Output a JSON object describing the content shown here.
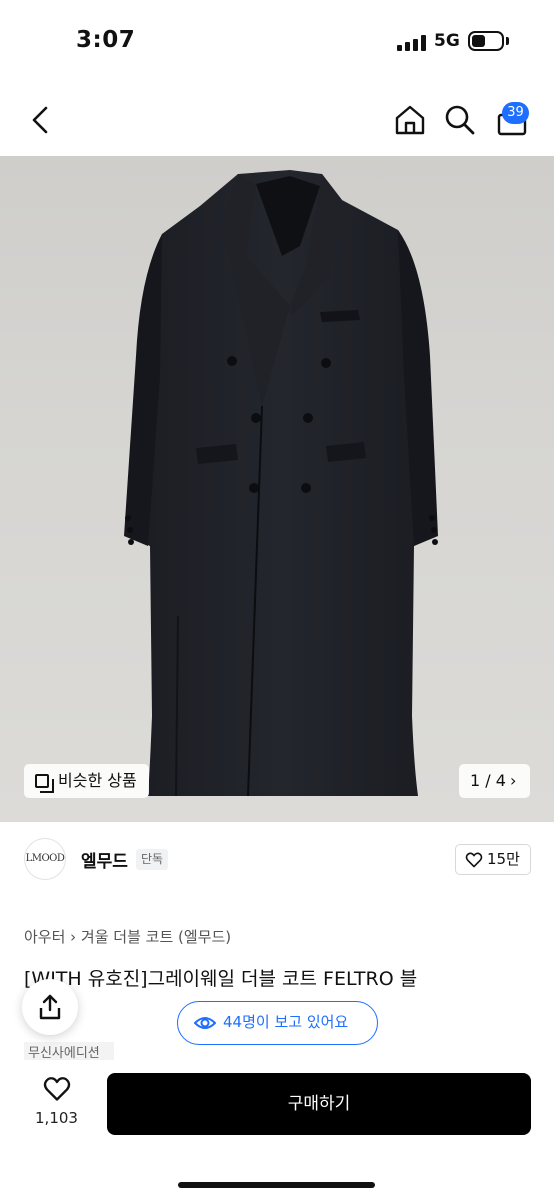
{
  "status_bar": {
    "time": "3:07",
    "network": "5G"
  },
  "nav": {
    "cart_count": "39"
  },
  "gallery": {
    "similar_label": "비슷한 상품",
    "page_indicator": "1 / 4",
    "page_arrow": "›"
  },
  "brand": {
    "logo_text": "LMOOD",
    "name": "엘무드",
    "tag": "단독"
  },
  "like": {
    "label": "15만"
  },
  "category": {
    "path": "아우터 › 겨울 더블 코트 (엘무드)"
  },
  "product": {
    "title": "[WITH 유호진]그레이웨일 더블 코트 FELTRO 블",
    "edition": "무신사에디션"
  },
  "viewers": {
    "label": "44명이 보고 있어요"
  },
  "bottom": {
    "like_count": "1,103",
    "buy_label": "구매하기"
  },
  "colors": {
    "accent": "#1e6fff",
    "buy_button": "#000000",
    "background": "#ffffff"
  },
  "icons": [
    "back-icon",
    "home-icon",
    "search-icon",
    "cart-icon",
    "similar-icon",
    "heart-icon",
    "eye-icon",
    "share-icon"
  ]
}
